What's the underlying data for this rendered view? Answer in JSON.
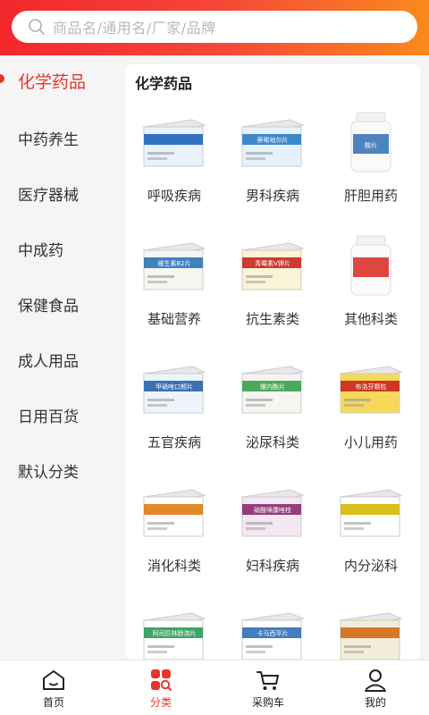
{
  "search": {
    "placeholder": "商品名/通用名/厂家/品牌"
  },
  "sidebar": {
    "items": [
      {
        "label": "化学药品",
        "active": true
      },
      {
        "label": "中药养生"
      },
      {
        "label": "医疗器械"
      },
      {
        "label": "中成药"
      },
      {
        "label": "保健食品"
      },
      {
        "label": "成人用品"
      },
      {
        "label": "日用百货"
      },
      {
        "label": "默认分类"
      }
    ]
  },
  "content": {
    "title": "化学药品",
    "items": [
      {
        "label": "呼吸疾病",
        "icon": "medicine-box-icon"
      },
      {
        "label": "男科疾病",
        "icon": "medicine-box-icon",
        "box_text": "萘哌地尔片"
      },
      {
        "label": "肝胆用药",
        "icon": "medicine-bottle-icon",
        "box_text": "酸片"
      },
      {
        "label": "基础营养",
        "icon": "medicine-box-icon",
        "box_text": "维生素B2片"
      },
      {
        "label": "抗生素类",
        "icon": "medicine-box-icon",
        "box_text": "青霉素V钾片"
      },
      {
        "label": "其他科类",
        "icon": "medicine-bottle-icon"
      },
      {
        "label": "五官疾病",
        "icon": "medicine-box-icon",
        "box_text": "甲硝唑口颊片"
      },
      {
        "label": "泌尿科类",
        "icon": "medicine-box-icon",
        "box_text": "螺内酯片"
      },
      {
        "label": "小儿用药",
        "icon": "medicine-box-icon",
        "box_text": "布洛芬颗粒"
      },
      {
        "label": "消化科类",
        "icon": "medicine-box-icon"
      },
      {
        "label": "妇科疾病",
        "icon": "medicine-box-icon",
        "box_text": "硝酸咪康唑栓"
      },
      {
        "label": "内分泌科",
        "icon": "medicine-box-icon"
      },
      {
        "label": "",
        "icon": "medicine-box-icon",
        "box_text": "阿司匹林肠溶片"
      },
      {
        "label": "",
        "icon": "medicine-box-icon",
        "box_text": "卡马西平片"
      },
      {
        "label": "",
        "icon": "medicine-box-icon"
      }
    ]
  },
  "tabbar": {
    "items": [
      {
        "label": "首页",
        "icon": "home-icon"
      },
      {
        "label": "分类",
        "icon": "category-icon",
        "active": true
      },
      {
        "label": "采购车",
        "icon": "cart-icon"
      },
      {
        "label": "我的",
        "icon": "user-icon"
      }
    ]
  },
  "colors": {
    "accent": "#e8352a",
    "header_start": "#f2282b",
    "header_end": "#fa8a1c"
  }
}
